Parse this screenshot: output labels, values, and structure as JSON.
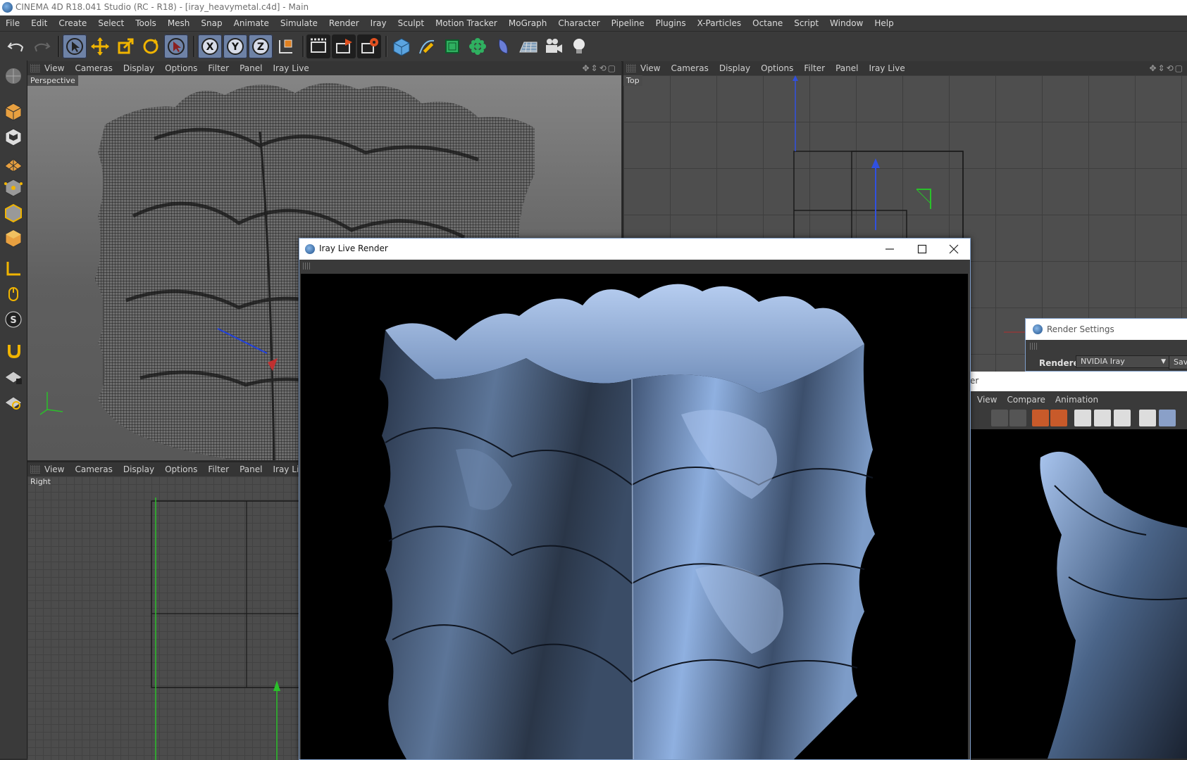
{
  "window": {
    "title": "CINEMA 4D R18.041 Studio (RC - R18) - [iray_heavymetal.c4d] - Main"
  },
  "menubar": [
    "File",
    "Edit",
    "Create",
    "Select",
    "Tools",
    "Mesh",
    "Snap",
    "Animate",
    "Simulate",
    "Render",
    "Iray",
    "Sculpt",
    "Motion Tracker",
    "MoGraph",
    "Character",
    "Pipeline",
    "Plugins",
    "X-Particles",
    "Octane",
    "Script",
    "Window",
    "Help"
  ],
  "toolbar": {
    "icons": [
      "undo-icon",
      "redo-icon",
      "select-arrow-icon",
      "move-icon",
      "scale-icon",
      "rotate-icon",
      "live-select-icon",
      "x-axis-icon",
      "y-axis-icon",
      "z-axis-icon",
      "world-coordinates-icon",
      "render-view-icon",
      "render-to-picture-viewer-icon",
      "render-settings-icon",
      "cube-icon",
      "pen-icon",
      "subdivision-icon",
      "cloner-icon",
      "deformer-icon",
      "floor-icon",
      "camera-icon",
      "light-icon"
    ],
    "x_label": "X",
    "y_label": "Y",
    "z_label": "Z"
  },
  "viewport_menu": [
    "View",
    "Cameras",
    "Display",
    "Options",
    "Filter",
    "Panel",
    "Iray Live"
  ],
  "viewports": {
    "perspective": {
      "label": "Perspective"
    },
    "top": {
      "label": "Top"
    },
    "right": {
      "label": "Right"
    }
  },
  "iray_window": {
    "title": "Iray Live Render"
  },
  "render_settings": {
    "title": "Render Settings",
    "renderer_label": "Renderer",
    "renderer_value": "NVIDIA Iray",
    "save_label": "Sav"
  },
  "picture_viewer": {
    "title_fragment": "er",
    "menu": [
      "View",
      "Compare",
      "Animation"
    ]
  },
  "colors": {
    "accent": "#6e82a6",
    "window_border": "#7f9ec9",
    "render_blue": "#8fb0e0"
  }
}
